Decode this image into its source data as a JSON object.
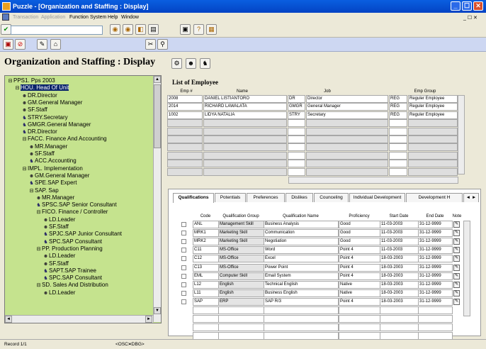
{
  "window": {
    "title": "Puzzle - [Organization and Staffing : Display]"
  },
  "menu": {
    "items": [
      "Transaction",
      "Application",
      "Function",
      "System",
      "Help",
      "Window"
    ],
    "right": "_ ☐ ✕"
  },
  "page": {
    "title": "Organization and Staffing : Display"
  },
  "tree": [
    {
      "label": "PPS1. Pps 2003",
      "icon": "⊟",
      "level": 0
    },
    {
      "label": "HOU. Head Of Unit",
      "icon": "⊟",
      "level": 1,
      "sel": true
    },
    {
      "label": "DR.Director",
      "icon": "☻",
      "level": 2
    },
    {
      "label": "GM.General Manager",
      "icon": "☻",
      "level": 2
    },
    {
      "label": "SF.Staff",
      "icon": "☻",
      "level": 2
    },
    {
      "label": "STRY.Secretary",
      "icon": "♞",
      "level": 2
    },
    {
      "label": "GMGR.General Manager",
      "icon": "♞",
      "level": 2
    },
    {
      "label": "DR.Director",
      "icon": "♞",
      "level": 2
    },
    {
      "label": "FACC. Finance And Accounting",
      "icon": "⊟",
      "level": 2
    },
    {
      "label": "MR.Manager",
      "icon": "☻",
      "level": 3
    },
    {
      "label": "SF.Staff",
      "icon": "☻",
      "level": 3
    },
    {
      "label": "ACC.Accounting",
      "icon": "♞",
      "level": 3
    },
    {
      "label": "IMPL. Implementation",
      "icon": "⊟",
      "level": 2
    },
    {
      "label": "GM.General Manager",
      "icon": "☻",
      "level": 3
    },
    {
      "label": "SPE.SAP Expert",
      "icon": "♞",
      "level": 3
    },
    {
      "label": "SAP. Sap",
      "icon": "⊟",
      "level": 3
    },
    {
      "label": "MR.Manager",
      "icon": "☻",
      "level": 4
    },
    {
      "label": "SPSC.SAP Senior Consultant",
      "icon": "♞",
      "level": 4
    },
    {
      "label": "FICO. Finance / Controller",
      "icon": "⊟",
      "level": 4
    },
    {
      "label": "LD.Leader",
      "icon": "☻",
      "level": 5
    },
    {
      "label": "SF.Staff",
      "icon": "☻",
      "level": 5
    },
    {
      "label": "SPJC.SAP Junior Consultant",
      "icon": "♞",
      "level": 5
    },
    {
      "label": "SPC.SAP Consultant",
      "icon": "♞",
      "level": 5
    },
    {
      "label": "PP. Production Planning",
      "icon": "⊟",
      "level": 4
    },
    {
      "label": "LD.Leader",
      "icon": "☻",
      "level": 5
    },
    {
      "label": "SF.Staff",
      "icon": "☻",
      "level": 5
    },
    {
      "label": "SAPT.SAP Trainee",
      "icon": "♞",
      "level": 5
    },
    {
      "label": "SPC.SAP Consultant",
      "icon": "♞",
      "level": 5
    },
    {
      "label": "SD. Sales And Distribution",
      "icon": "⊟",
      "level": 4
    },
    {
      "label": "LD.Leader",
      "icon": "☻",
      "level": 5
    }
  ],
  "employees": {
    "title": "List of Employee",
    "headers": {
      "emp": "Emp #",
      "name": "Name",
      "job": "Job",
      "group": "Emp Group"
    },
    "rows": [
      {
        "emp": "2008",
        "name": "DANIEL LISTIANTORO",
        "jobcode": "DR",
        "job": "Director",
        "grpcode": "REG",
        "grp": "Reguler Employee"
      },
      {
        "emp": "2014",
        "name": "RICHARD LAWALATA",
        "jobcode": "GMGR",
        "job": "General Manager",
        "grpcode": "REG",
        "grp": "Reguler Employee"
      },
      {
        "emp": "1002",
        "name": "LIDYA NATALIA",
        "jobcode": "STRY",
        "job": "Secretary",
        "grpcode": "REG",
        "grp": "Reguler Employee"
      }
    ]
  },
  "tabs": [
    "Qualifications",
    "Potentials",
    "Preferences",
    "Dislikes",
    "Counceling",
    "Individual Development",
    "Development H"
  ],
  "qual": {
    "headers": {
      "code": "Code",
      "group": "Qualification Group",
      "name": "Qualification Name",
      "prof": "Proficiency",
      "start": "Start Date",
      "end": "End Date",
      "note": "Note"
    },
    "rows": [
      {
        "code": "ANL",
        "group": "Management Skill",
        "name": "Business Analysis",
        "prof": "Good",
        "start": "11-03-2003",
        "end": "31-12-9999"
      },
      {
        "code": "MRK1",
        "group": "Marketing Skill",
        "name": "Communication",
        "prof": "Good",
        "start": "11-03-2003",
        "end": "31-12-9999"
      },
      {
        "code": "MRK2",
        "group": "Marketing Skill",
        "name": "Negotiation",
        "prof": "Good",
        "start": "11-03-2003",
        "end": "31-12-9999"
      },
      {
        "code": "C11",
        "group": "MS-Office",
        "name": "Word",
        "prof": "Point 4",
        "start": "11-03-2003",
        "end": "31-12-9999"
      },
      {
        "code": "C12",
        "group": "MS-Office",
        "name": "Excel",
        "prof": "Point 4",
        "start": "18-03-2003",
        "end": "31-12-9999"
      },
      {
        "code": "C13",
        "group": "MS-Office",
        "name": "Power Point",
        "prof": "Point 4",
        "start": "18-03-2003",
        "end": "31-12-9999"
      },
      {
        "code": "EML",
        "group": "Computer Skill",
        "name": "Email System",
        "prof": "Point 4",
        "start": "18-03-2003",
        "end": "31-12-9999"
      },
      {
        "code": "L12",
        "group": "English",
        "name": "Technical English",
        "prof": "Native",
        "start": "18-03-2003",
        "end": "31-12-9999"
      },
      {
        "code": "L11",
        "group": "English",
        "name": "Business English",
        "prof": "Native",
        "start": "18-03-2003",
        "end": "31-12-9999"
      },
      {
        "code": "SAP",
        "group": "ERP",
        "name": "SAP R/3",
        "prof": "Point 4",
        "start": "18-03-2003",
        "end": "31-12-9999"
      }
    ]
  },
  "status": {
    "record": "Record 1/1",
    "osc": "<OSC>",
    "dbg": "<DBG>"
  }
}
